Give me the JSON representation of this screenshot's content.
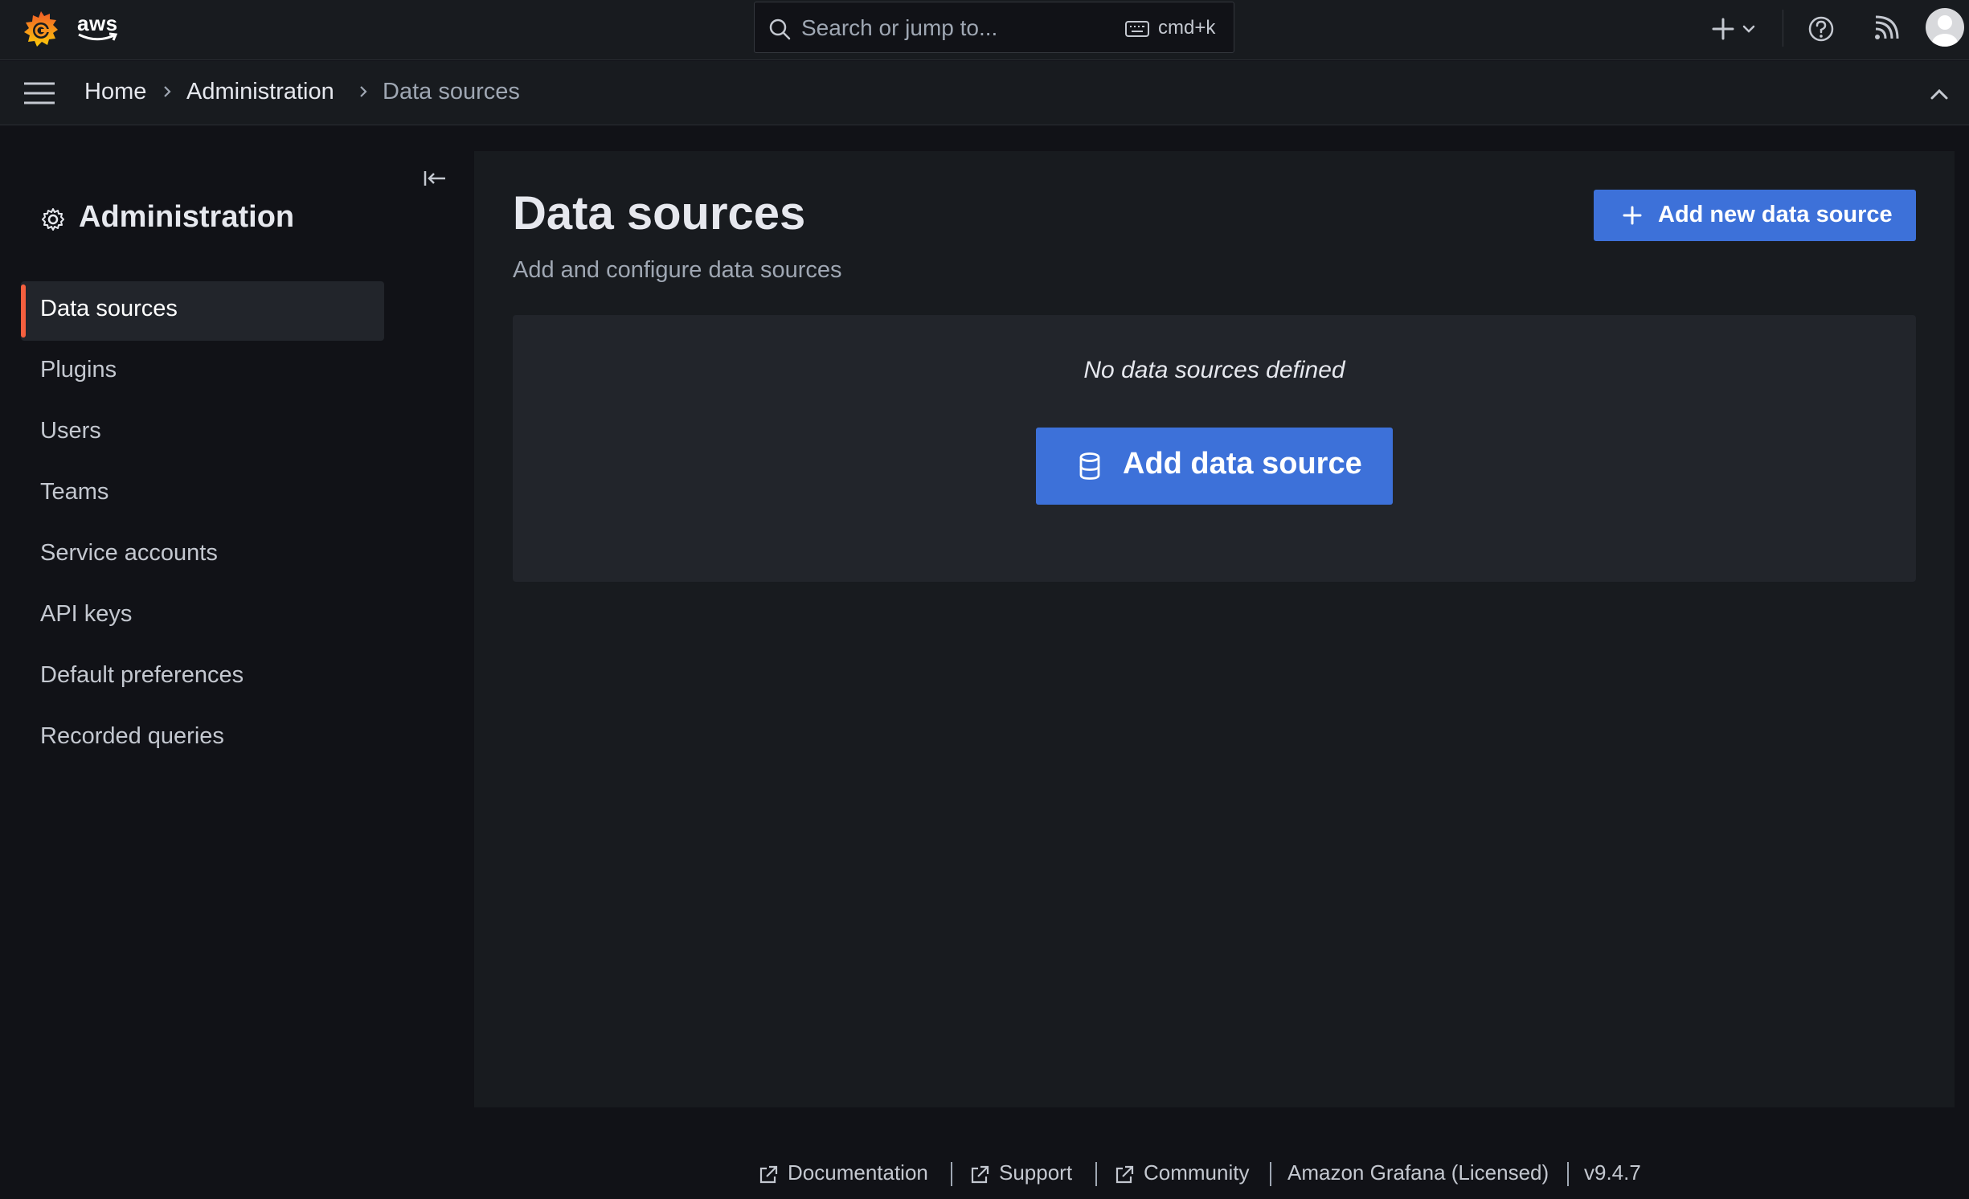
{
  "topbar": {
    "brand": "aws",
    "search_placeholder": "Search or jump to...",
    "search_shortcut": "cmd+k",
    "icons": [
      "grafana-logo-icon",
      "search-icon",
      "keyboard-icon",
      "plus-icon",
      "chevron-down-icon",
      "help-icon",
      "news-feed-icon",
      "user-avatar"
    ]
  },
  "breadcrumb": {
    "items": [
      "Home",
      "Administration",
      "Data sources"
    ]
  },
  "sidebar": {
    "title": "Administration",
    "items": [
      {
        "label": "Data sources",
        "active": true
      },
      {
        "label": "Plugins",
        "active": false
      },
      {
        "label": "Users",
        "active": false
      },
      {
        "label": "Teams",
        "active": false
      },
      {
        "label": "Service accounts",
        "active": false
      },
      {
        "label": "API keys",
        "active": false
      },
      {
        "label": "Default preferences",
        "active": false
      },
      {
        "label": "Recorded queries",
        "active": false
      }
    ]
  },
  "main": {
    "title": "Data sources",
    "subtitle": "Add and configure data sources",
    "add_new_label": "Add new data source",
    "empty_message": "No data sources defined",
    "add_data_source_label": "Add data source"
  },
  "footer": {
    "documentation": "Documentation",
    "support": "Support",
    "community": "Community",
    "license": "Amazon Grafana (Licensed)",
    "version": "v9.4.7"
  },
  "colors": {
    "background": "#111217",
    "panel": "#181b1f",
    "card": "#22252b",
    "primary_button": "#3d71d9",
    "active_indicator": "#f55f3e"
  }
}
